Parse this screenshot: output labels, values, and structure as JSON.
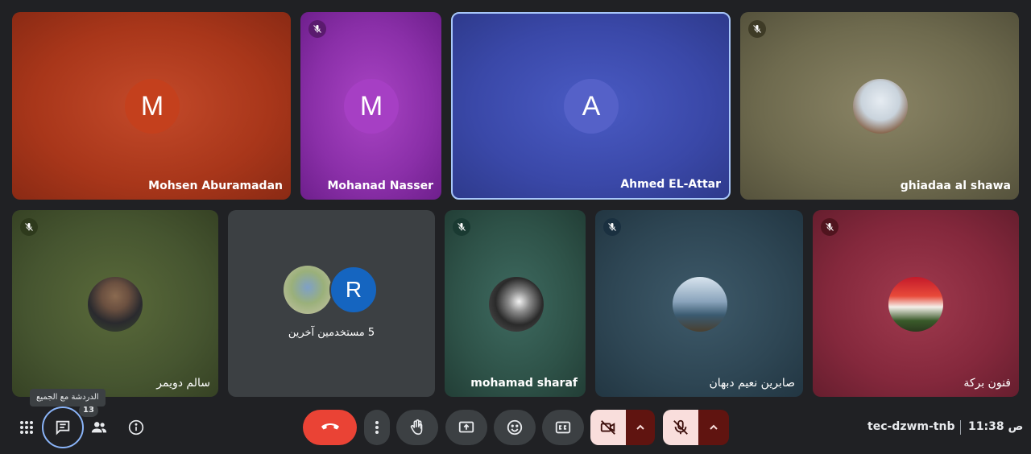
{
  "participants": [
    {
      "name": "Mohsen Aburamadan",
      "initial": "M"
    },
    {
      "name": "Mohanad Nasser",
      "initial": "M"
    },
    {
      "name": "Ahmed EL-Attar",
      "initial": "A"
    },
    {
      "name": "ghiadaa al shawa"
    },
    {
      "name": "سالم دويمر"
    },
    {
      "name": "mohamad sharaf"
    },
    {
      "name": "صابرين نعيم دبهان"
    },
    {
      "name": "فنون بركة"
    }
  ],
  "others": {
    "label": "5 مستخدمين آخرين",
    "initial": "R"
  },
  "toolbar": {
    "chat_tooltip": "الدردشة مع الجميع",
    "chat_badge": "13"
  },
  "meeting": {
    "code": "tec-dzwm-tnb",
    "time": "11:38 ص"
  },
  "colors": {
    "background": "#202124",
    "end_call": "#ea4335",
    "muted_control": "#f9dedc",
    "muted_arrow": "#601410",
    "active_speaker_border": "#a8c7fa"
  }
}
